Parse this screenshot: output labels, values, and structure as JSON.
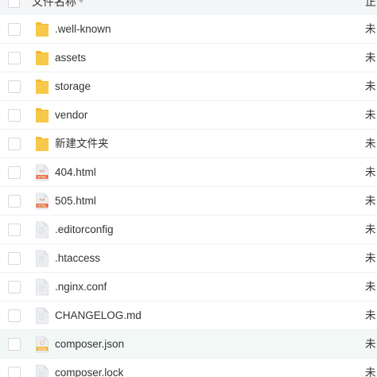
{
  "header": {
    "name_label": "文件名称",
    "status_label": "正"
  },
  "colors": {
    "folder": "#f7c94b",
    "folder_tab": "#f3b92f",
    "file_page": "#eceef1",
    "html_badge": "#e86a3a",
    "json_badge": "#f0b33c",
    "row_hover": "#f1f8f6"
  },
  "rows": [
    {
      "name": ".well-known",
      "type": "folder",
      "icon": "folder-icon",
      "status": "未"
    },
    {
      "name": "assets",
      "type": "folder",
      "icon": "folder-icon",
      "status": "未"
    },
    {
      "name": "storage",
      "type": "folder",
      "icon": "folder-icon",
      "status": "未"
    },
    {
      "name": "vendor",
      "type": "folder",
      "icon": "folder-icon",
      "status": "未"
    },
    {
      "name": "新建文件夹",
      "type": "folder",
      "icon": "folder-icon",
      "status": "未"
    },
    {
      "name": "404.html",
      "type": "html",
      "icon": "html-file-icon",
      "badge": "HTML",
      "status": "未"
    },
    {
      "name": "505.html",
      "type": "html",
      "icon": "html-file-icon",
      "badge": "HTML",
      "status": "未"
    },
    {
      "name": ".editorconfig",
      "type": "file",
      "icon": "file-icon",
      "status": "未"
    },
    {
      "name": ".htaccess",
      "type": "file",
      "icon": "file-icon",
      "status": "未"
    },
    {
      "name": ".nginx.conf",
      "type": "file",
      "icon": "file-icon",
      "status": "未"
    },
    {
      "name": "CHANGELOG.md",
      "type": "file",
      "icon": "file-icon",
      "status": "未"
    },
    {
      "name": "composer.json",
      "type": "json",
      "icon": "json-file-icon",
      "badge": "JSON",
      "status": "未",
      "hovered": true
    },
    {
      "name": "composer.lock",
      "type": "file",
      "icon": "file-icon",
      "status": "未"
    }
  ]
}
